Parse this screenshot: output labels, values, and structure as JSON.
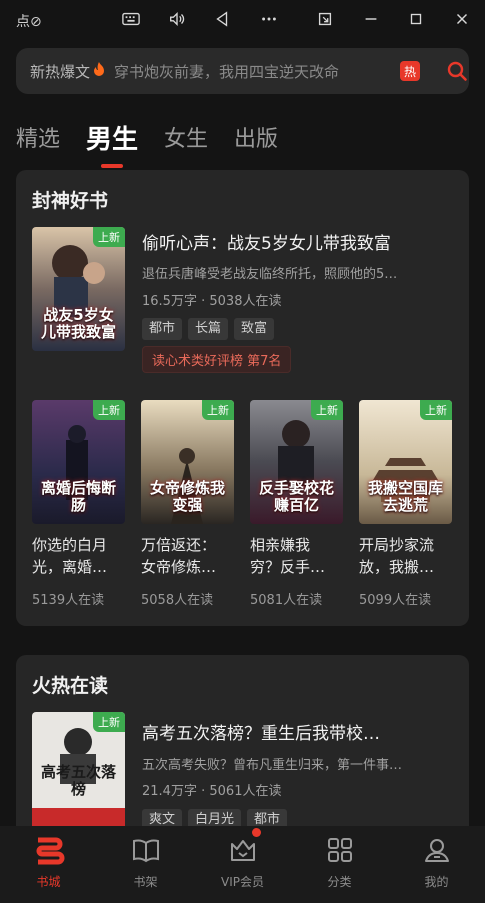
{
  "window": {
    "title": "点⊘"
  },
  "search": {
    "hot_label": "新热爆文",
    "hint": "穿书炮灰前妻，我用四宝逆天改命",
    "badge": "热"
  },
  "tabs": [
    {
      "label": "精选"
    },
    {
      "label": "男生"
    },
    {
      "label": "女生"
    },
    {
      "label": "出版"
    }
  ],
  "section1": {
    "title": "封神好书",
    "featured": {
      "badge": "上新",
      "cover_text": "战友5岁女儿带我致富",
      "title": "偷听心声：战友5岁女儿带我致富",
      "desc": "退伍兵唐峰受老战友临终所托，照顾他的5…",
      "words": "16.5万字",
      "dot": "·",
      "readers": "5038人在读",
      "tags": [
        "都市",
        "长篇",
        "致富"
      ],
      "rank": "读心术类好评榜  第7名"
    },
    "grid": [
      {
        "badge": "上新",
        "cover_text": "离婚后悔断肠",
        "title1": "你选的白月",
        "title2": "光，离婚…",
        "readers": "5139人在读"
      },
      {
        "badge": "上新",
        "cover_text": "女帝修炼我变强",
        "title1": "万倍返还：",
        "title2": "女帝修炼…",
        "readers": "5058人在读"
      },
      {
        "badge": "上新",
        "cover_text": "反手娶校花赚百亿",
        "title1": "相亲嫌我",
        "title2": "穷？反手…",
        "readers": "5081人在读"
      },
      {
        "badge": "上新",
        "cover_text": "我搬空国库去逃荒",
        "title1": "开局抄家流",
        "title2": "放，我搬…",
        "readers": "5099人在读"
      }
    ]
  },
  "section2": {
    "title": "火热在读",
    "featured": {
      "badge": "上新",
      "cover_text": "高考五次落榜",
      "title": "高考五次落榜？重生后我带校…",
      "desc": "五次高考失败？曾布凡重生归来，第一件事…",
      "words": "21.4万字",
      "dot": "·",
      "readers": "5061人在读",
      "tags": [
        "爽文",
        "白月光",
        "都市"
      ]
    }
  },
  "bottom_nav": [
    {
      "label": "书城",
      "icon": "bookstore-icon"
    },
    {
      "label": "书架",
      "icon": "bookshelf-icon"
    },
    {
      "label": "VIP会员",
      "icon": "vip-crown-icon"
    },
    {
      "label": "分类",
      "icon": "category-grid-icon"
    },
    {
      "label": "我的",
      "icon": "profile-icon"
    }
  ],
  "colors": {
    "accent": "#e8382a",
    "badge_green": "#3dab4f",
    "background": "#141414",
    "card": "#262626"
  }
}
